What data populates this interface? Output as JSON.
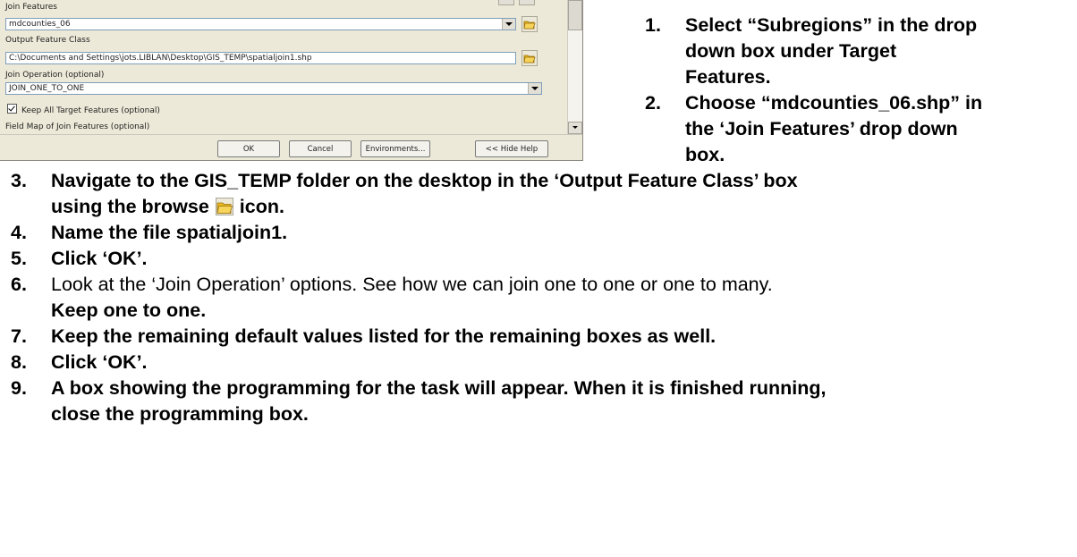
{
  "dialog": {
    "join_features_label": "Join Features",
    "join_features_value": "mdcounties_06",
    "output_class_label": "Output Feature Class",
    "output_class_value": "C:\\Documents and Settings\\jots.LIBLAN\\Desktop\\GIS_TEMP\\spatialjoin1.shp",
    "join_operation_label": "Join Operation (optional)",
    "join_operation_value": "JOIN_ONE_TO_ONE",
    "keep_all_label": "Keep All Target Features (optional)",
    "keep_all_checked": true,
    "field_map_label": "Field Map of Join Features (optional)",
    "buttons": {
      "ok": "OK",
      "cancel": "Cancel",
      "environments": "Environments...",
      "hide_help": "<< Hide Help"
    }
  },
  "instructions": [
    {
      "number": "1.",
      "lines": [
        "Select “Subregions” in the drop",
        "down box under Target",
        "Features."
      ]
    },
    {
      "number": "2.",
      "lines": [
        "Choose “mdcounties_06.shp” in",
        "the ‘Join Features’ drop down",
        "box."
      ]
    },
    {
      "number": "3.",
      "line1": "Navigate to the GIS_TEMP folder on the desktop in the ‘Output Feature Class’ box",
      "line2_before": "using the browse",
      "line2_after": "icon."
    },
    {
      "number": "4.",
      "text": "Name the file spatialjoin1."
    },
    {
      "number": "5.",
      "text": "Click ‘OK’."
    },
    {
      "number": "6.",
      "line1": "Look at the ‘Join Operation’ options. See how we can join one to one or one to many.",
      "line2": "Keep one to one."
    },
    {
      "number": "7.",
      "text": "Keep the remaining default values listed for the remaining boxes as well."
    },
    {
      "number": "8.",
      "text": "Click ‘OK’."
    },
    {
      "number": "9.",
      "line1": "A box showing the programming for the task will appear. When it is finished running,",
      "line2": "close the programming box."
    }
  ],
  "icons": {
    "browse": "folder-open-icon"
  }
}
